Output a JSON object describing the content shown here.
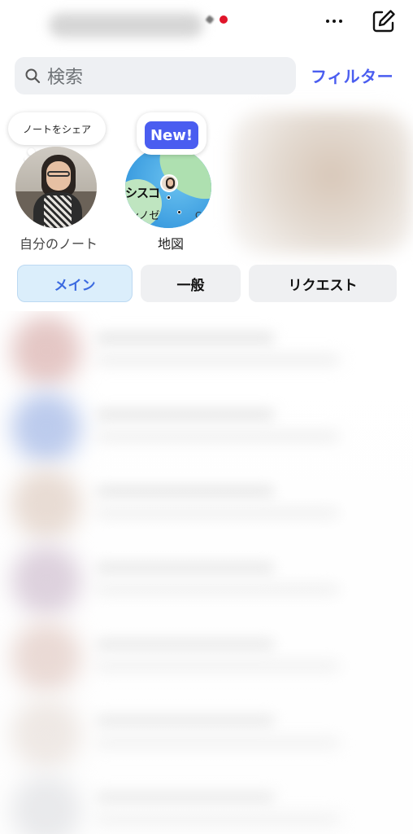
{
  "header": {
    "more_icon": "ellipsis-icon",
    "compose_icon": "compose-icon",
    "unread_dot_color": "#e0152a"
  },
  "search": {
    "placeholder": "検索",
    "icon": "search-icon",
    "filter_label": "フィルター",
    "accent_color": "#4a5df0"
  },
  "notes": {
    "self": {
      "bubble_text": "ノートをシェア",
      "label": "自分のノート"
    },
    "map": {
      "badge": "New!",
      "label": "地図",
      "map_text_1": "シスコ",
      "map_text_2": "ンノゼ",
      "map_text_3": "C"
    }
  },
  "tabs": [
    {
      "label": "メイン",
      "selected": true
    },
    {
      "label": "一般",
      "selected": false
    },
    {
      "label": "リクエスト",
      "selected": false
    }
  ],
  "messages": [
    {
      "avatar_color": "#e4c6c4"
    },
    {
      "avatar_color": "#b8c8ec"
    },
    {
      "avatar_color": "#e6d8cf"
    },
    {
      "avatar_color": "#d8cad8"
    },
    {
      "avatar_color": "#e6d2cc"
    },
    {
      "avatar_color": "#ebe3de"
    },
    {
      "avatar_color": "#e2e3e6"
    }
  ]
}
